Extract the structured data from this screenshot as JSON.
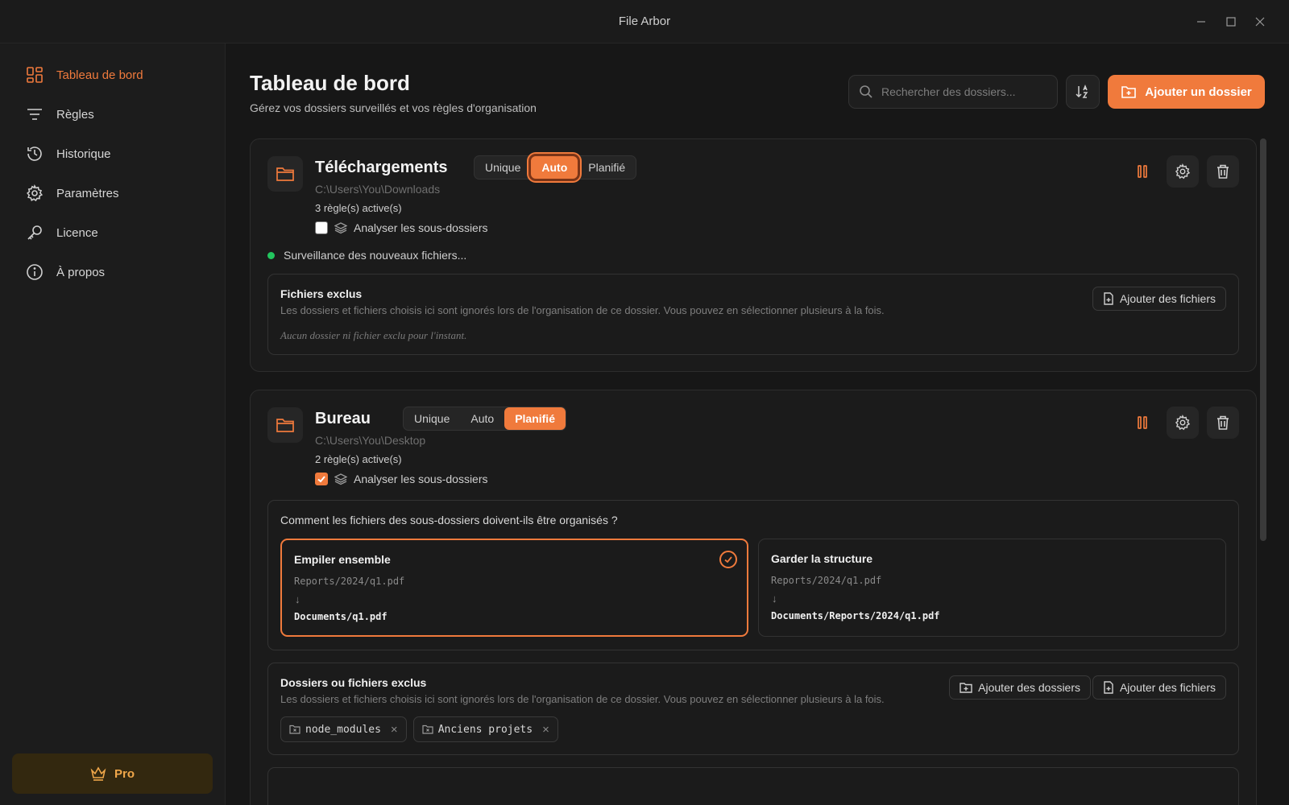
{
  "window": {
    "title": "File Arbor"
  },
  "sidebar": {
    "items": [
      {
        "label": "Tableau de bord",
        "icon": "dashboard-icon",
        "active": true
      },
      {
        "label": "Règles",
        "icon": "filter-icon"
      },
      {
        "label": "Historique",
        "icon": "history-icon"
      },
      {
        "label": "Paramètres",
        "icon": "gear-icon"
      },
      {
        "label": "Licence",
        "icon": "key-icon"
      },
      {
        "label": "À propos",
        "icon": "info-icon"
      }
    ],
    "pro_label": "Pro"
  },
  "header": {
    "title": "Tableau de bord",
    "subtitle": "Gérez vos dossiers surveillés et vos règles d'organisation",
    "search_placeholder": "Rechercher des dossiers...",
    "add_label": "Ajouter un dossier"
  },
  "modes": [
    "Unique",
    "Auto",
    "Planifié"
  ],
  "folders": [
    {
      "name": "Téléchargements",
      "path": "C:\\Users\\You\\Downloads",
      "rules": "3 règle(s) active(s)",
      "subfolders_label": "Analyser les sous-dossiers",
      "subfolders_checked": false,
      "mode": "Auto",
      "status": "Surveillance des nouveaux fichiers...",
      "excluded": {
        "title": "Fichiers exclus",
        "description": "Les dossiers et fichiers choisis ici sont ignorés lors de l'organisation de ce dossier. Vous pouvez en sélectionner plusieurs à la fois.",
        "empty": "Aucun dossier ni fichier exclu pour l'instant.",
        "add_files_label": "Ajouter des fichiers"
      }
    },
    {
      "name": "Bureau",
      "path": "C:\\Users\\You\\Desktop",
      "rules": "2 règle(s) active(s)",
      "subfolders_label": "Analyser les sous-dossiers",
      "subfolders_checked": true,
      "mode": "Planifié",
      "organize": {
        "question": "Comment les fichiers des sous-dossiers doivent-ils être organisés ?",
        "options": [
          {
            "title": "Empiler ensemble",
            "src": "Reports/2024/q1.pdf",
            "arrow": "↓",
            "dst": "Documents/q1.pdf",
            "selected": true
          },
          {
            "title": "Garder la structure",
            "src": "Reports/2024/q1.pdf",
            "arrow": "↓",
            "dst": "Documents/Reports/2024/q1.pdf",
            "selected": false
          }
        ]
      },
      "excluded": {
        "title": "Dossiers ou fichiers exclus",
        "description": "Les dossiers et fichiers choisis ici sont ignorés lors de l'organisation de ce dossier. Vous pouvez en sélectionner plusieurs à la fois.",
        "add_folders_label": "Ajouter des dossiers",
        "add_files_label": "Ajouter des fichiers",
        "items": [
          "node_modules",
          "Anciens projets"
        ]
      }
    }
  ],
  "colors": {
    "accent": "#f07a3c",
    "status_ok": "#22c55e",
    "pro_text": "#f0a74a"
  }
}
